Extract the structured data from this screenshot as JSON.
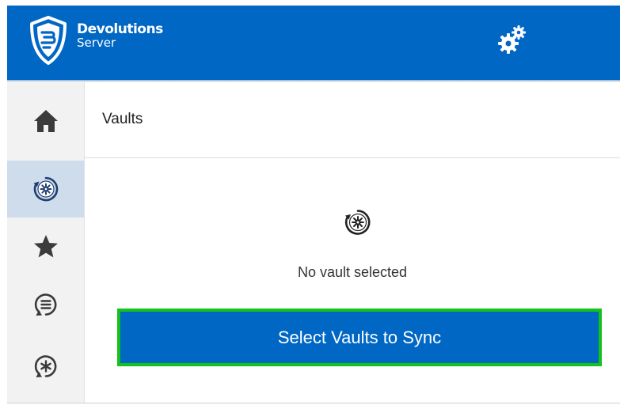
{
  "header": {
    "brand_name": "Devolutions",
    "brand_sub": "Server",
    "logo_icon": "devolutions-shield-icon",
    "settings_icon": "gears-icon",
    "color": "#0067c5"
  },
  "sidebar": {
    "items": [
      {
        "icon": "home-icon",
        "active": false
      },
      {
        "icon": "vault-icon",
        "active": true
      },
      {
        "icon": "star-icon",
        "active": false
      },
      {
        "icon": "sync-list-icon",
        "active": false
      },
      {
        "icon": "sync-asterisk-icon",
        "active": false
      }
    ],
    "active_color": "#cfdcec"
  },
  "main": {
    "title": "Vaults",
    "empty_icon": "vault-icon",
    "empty_text": "No vault selected",
    "select_button_label": "Select Vaults to Sync",
    "button_color": "#0067c5",
    "highlight_color": "#14c21a"
  }
}
